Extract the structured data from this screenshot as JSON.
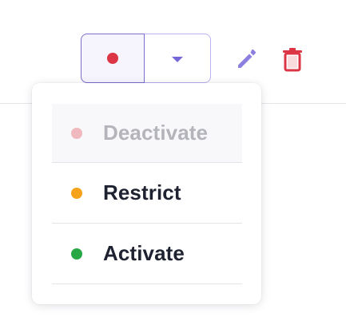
{
  "status_button": {
    "current_status": "deactivated",
    "current_dot_color": "#dc3545",
    "main_icon": "status-dot",
    "toggle_icon": "caret-down-icon",
    "accent_color": "#7467d8"
  },
  "actions": {
    "edit_icon": "pencil-icon",
    "edit_color": "#8b7fe0",
    "delete_icon": "trash-icon",
    "delete_color": "#dc3545"
  },
  "menu": {
    "items": [
      {
        "label": "Deactivate",
        "dot_color": "#f0b8bf",
        "disabled": true
      },
      {
        "label": "Restrict",
        "dot_color": "#f7a21b",
        "disabled": false
      },
      {
        "label": "Activate",
        "dot_color": "#28a745",
        "disabled": false
      }
    ]
  }
}
